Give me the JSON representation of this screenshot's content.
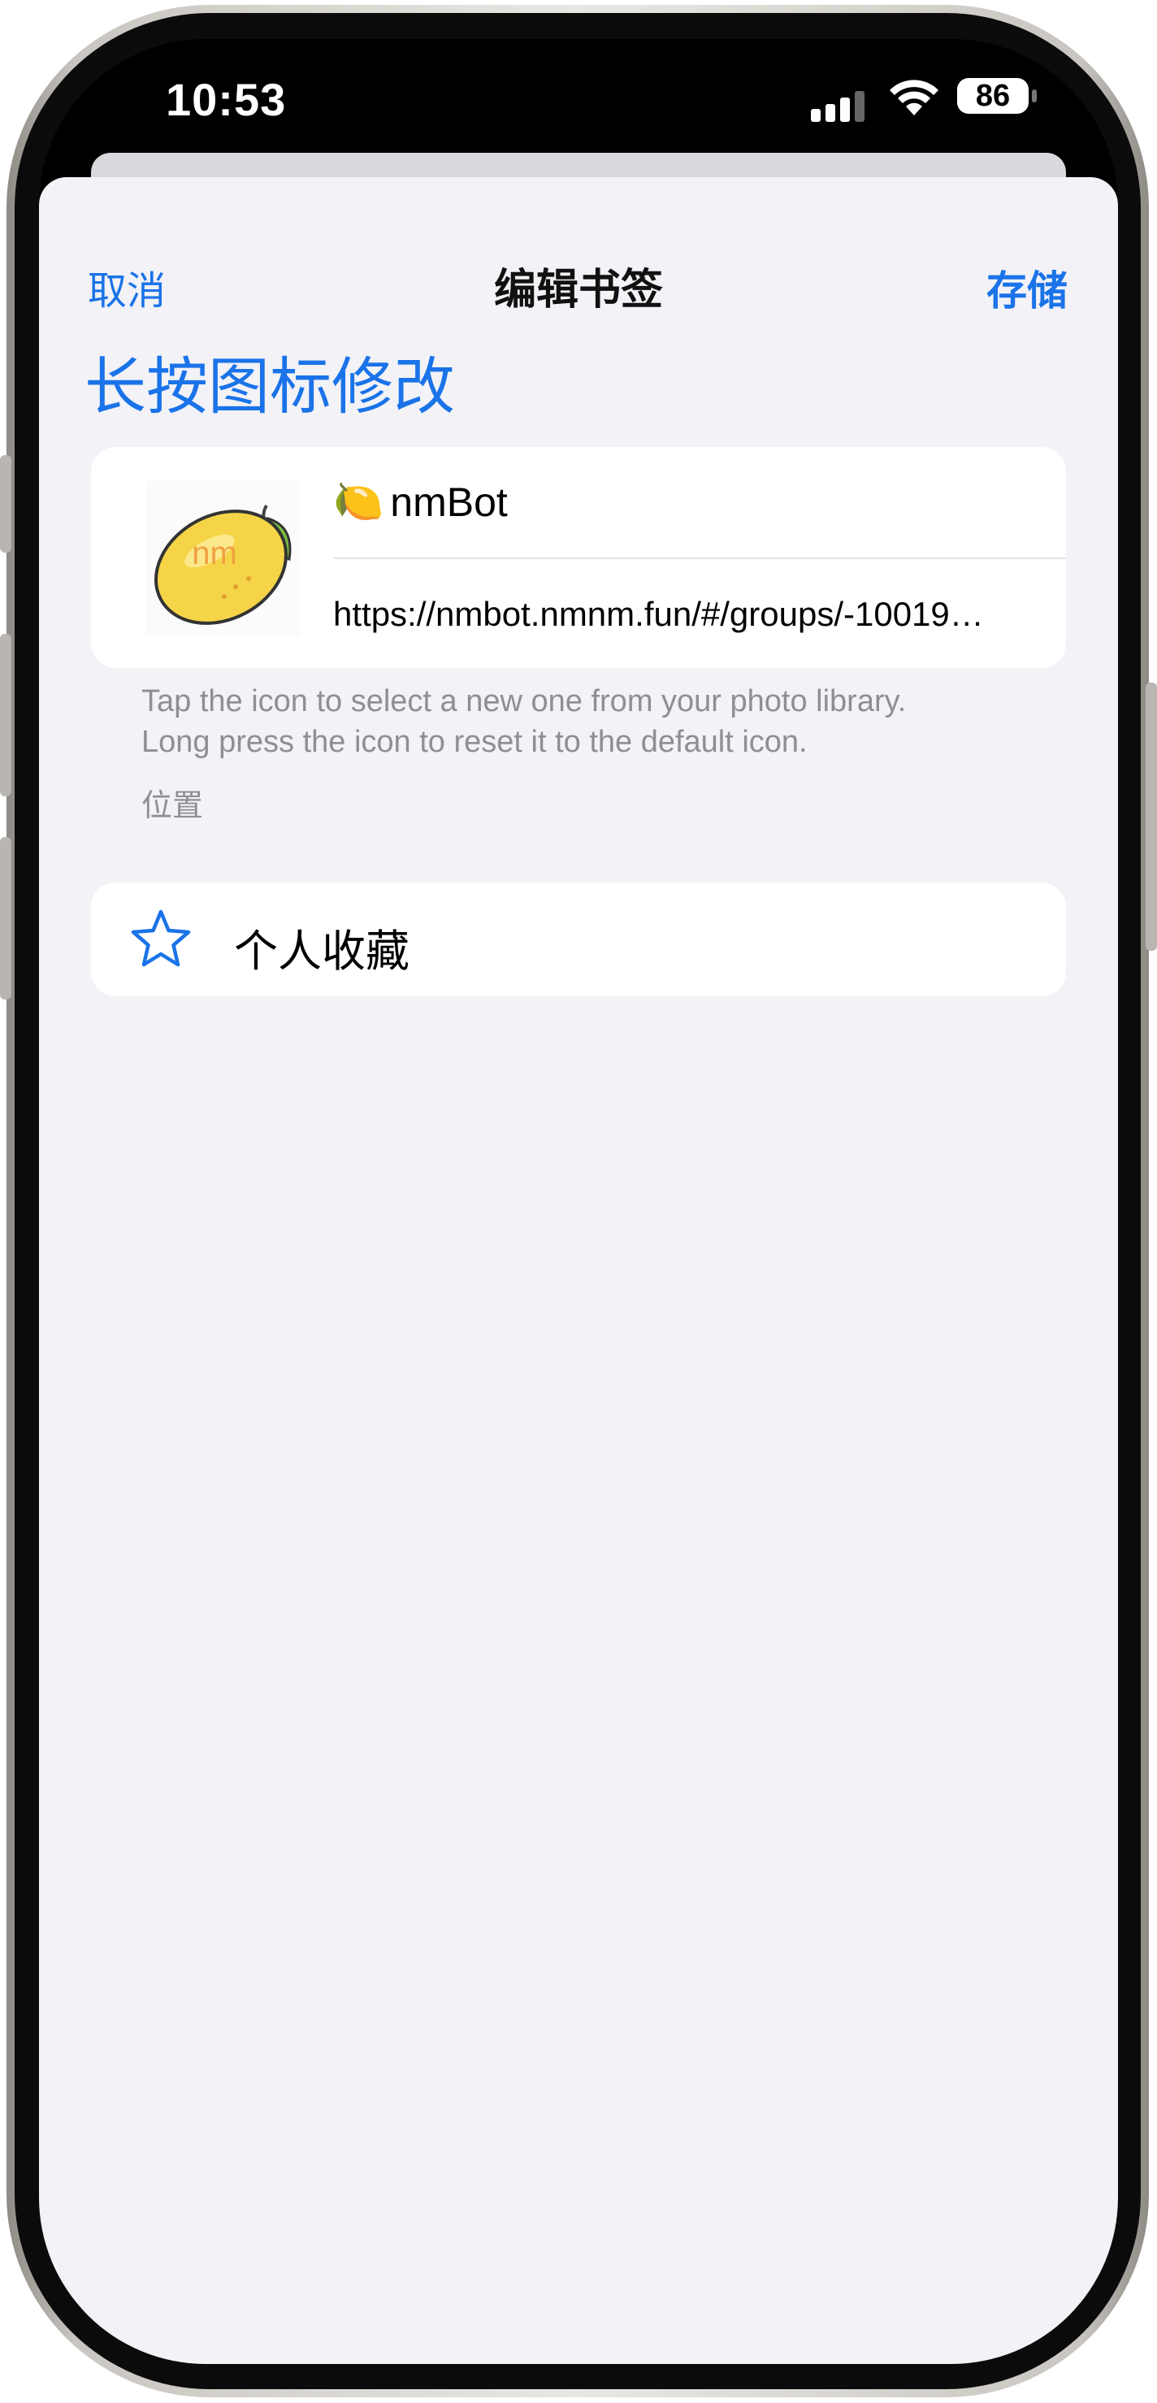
{
  "status_bar": {
    "time": "10:53",
    "battery": "86"
  },
  "nav": {
    "cancel": "取消",
    "title": "编辑书签",
    "save": "存储"
  },
  "header": {
    "title": "长按图标修改"
  },
  "bookmark": {
    "icon_text": "nm",
    "name_emoji": "🍋",
    "name": "nmBot",
    "url": "https://nmbot.nmnm.fun/#/groups/-10019…"
  },
  "hint": {
    "line1": "Tap the icon to select a new one from your photo library.",
    "line2": "Long press the icon to reset it to the default icon."
  },
  "location": {
    "section_label": "位置",
    "value": "个人收藏"
  },
  "colors": {
    "accent": "#1a73e8",
    "background": "#f2f2f7",
    "secondary_text": "#8e8e93"
  }
}
